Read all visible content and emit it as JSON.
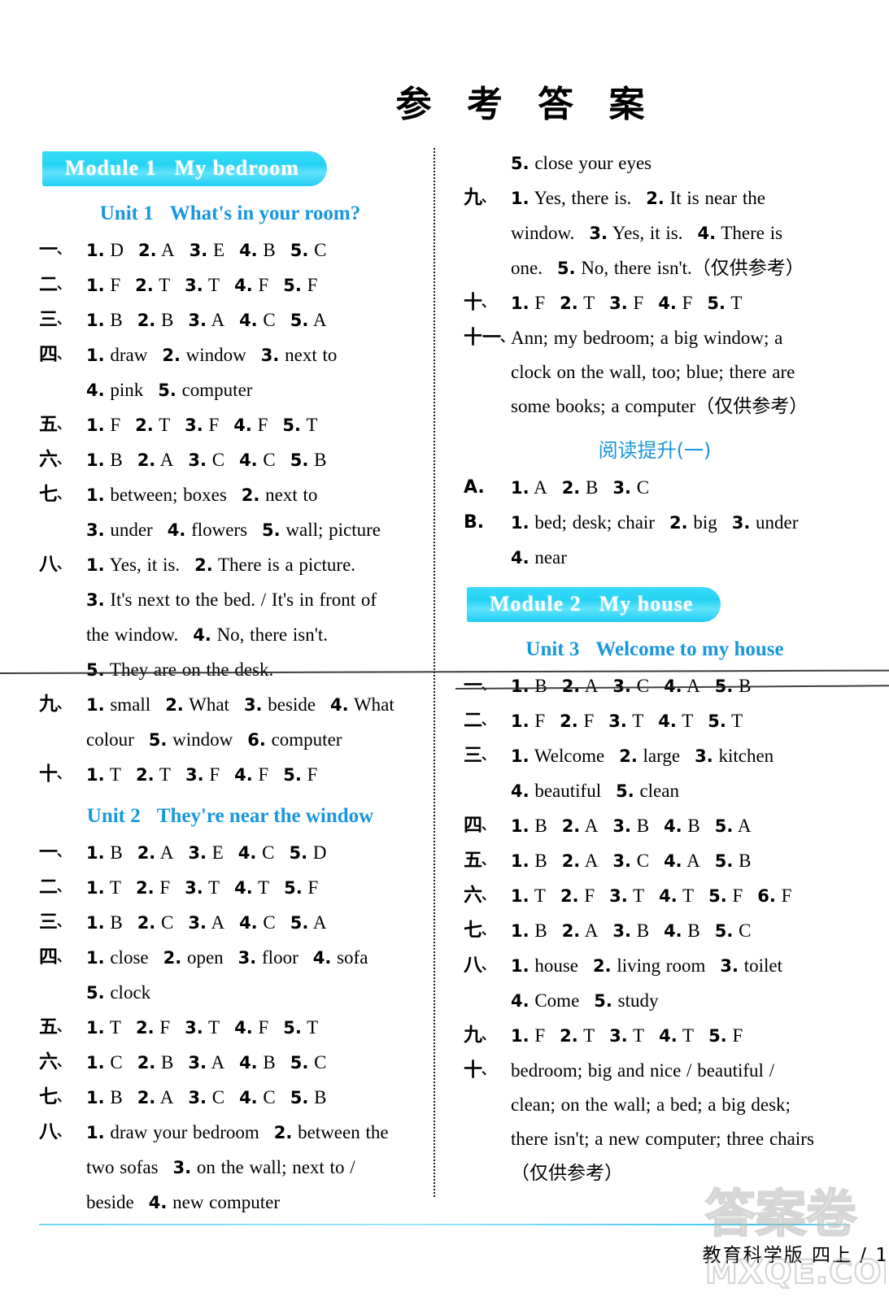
{
  "page": {
    "title": "参 考 答 案",
    "footer": "教育科学版 四上 / 1",
    "watermark_cn": "答案卷",
    "watermark_site": "MXQE.COM",
    "accent_cyan": "#25d2f4",
    "heading_blue": "#1897dd"
  },
  "left": {
    "module": {
      "name": "Module 1",
      "title": "My bedroom"
    },
    "unit1": {
      "name": "Unit 1",
      "title": "What's in your room?"
    },
    "unit1_answers": [
      {
        "label": "一、",
        "text": "1. D  2. A  3. E  4. B  5. C"
      },
      {
        "label": "二、",
        "text": "1. F  2. T  3. T  4. F  5. F"
      },
      {
        "label": "三、",
        "text": "1. B  2. B  3. A  4. C  5. A"
      },
      {
        "label": "四、",
        "text": "1. draw  2. window  3. next to"
      },
      {
        "label": "",
        "text": "4. pink  5. computer"
      },
      {
        "label": "五、",
        "text": "1. F  2. T  3. F  4. F  5. T"
      },
      {
        "label": "六、",
        "text": "1. B  2. A  3. C  4. C  5. B"
      },
      {
        "label": "七、",
        "text": "1. between; boxes  2. next to"
      },
      {
        "label": "",
        "text": "3. under  4. flowers  5. wall; picture"
      },
      {
        "label": "八、",
        "text": "1. Yes, it is.  2. There is a picture."
      },
      {
        "label": "",
        "text": "3. It's next to the bed. / It's in front of"
      },
      {
        "label": "",
        "text": "the window.  4. No, there isn't."
      },
      {
        "label": "",
        "text": "5. They are on the desk."
      },
      {
        "label": "九、",
        "text": "1. small  2. What  3. beside  4. What"
      },
      {
        "label": "",
        "text": "colour  5. window  6. computer"
      },
      {
        "label": "十、",
        "text": "1. T  2. T  3. F  4. F  5. F"
      }
    ],
    "unit2": {
      "name": "Unit 2",
      "title": "They're near the window"
    },
    "unit2_answers": [
      {
        "label": "一、",
        "text": "1. B  2. A  3. E  4. C  5. D"
      },
      {
        "label": "二、",
        "text": "1. T  2. F  3. T  4. T  5. F"
      },
      {
        "label": "三、",
        "text": "1. B  2. C  3. A  4. C  5. A"
      },
      {
        "label": "四、",
        "text": "1. close  2. open  3. floor  4. sofa"
      },
      {
        "label": "",
        "text": "5. clock"
      },
      {
        "label": "五、",
        "text": "1. T  2. F  3. T  4. F  5. T"
      },
      {
        "label": "六、",
        "text": "1. C  2. B  3. A  4. B  5. C"
      },
      {
        "label": "七、",
        "text": "1. B  2. A  3. C  4. C  5. B"
      },
      {
        "label": "八、",
        "text": "1. draw your bedroom  2. between the"
      },
      {
        "label": "",
        "text": "two sofas  3. on the wall; next to /"
      },
      {
        "label": "",
        "text": "beside  4. new computer"
      }
    ]
  },
  "right": {
    "unit2_cont": [
      {
        "label": "",
        "text": "5. close your eyes"
      },
      {
        "label": "九、",
        "text": "1. Yes, there is.  2. It is near the"
      },
      {
        "label": "",
        "text": "window.  3. Yes, it is.  4. There is"
      },
      {
        "label": "",
        "text": "one.  5. No, there isn't.（仅供参考）"
      },
      {
        "label": "十、",
        "text": "1. F  2. T  3. F  4. F  5. T"
      },
      {
        "label": "十一、",
        "text": "Ann; my bedroom; a big window; a"
      },
      {
        "label": "",
        "text": "clock on the wall, too; blue; there are"
      },
      {
        "label": "",
        "text": "some books; a computer（仅供参考）"
      }
    ],
    "reading": {
      "title": "阅读提升(一)"
    },
    "reading_answers": [
      {
        "label": "A.",
        "text": "1. A  2. B  3. C"
      },
      {
        "label": "B.",
        "text": "1. bed; desk; chair  2. big  3. under"
      },
      {
        "label": "",
        "text": "4. near"
      }
    ],
    "module": {
      "name": "Module 2",
      "title": "My house"
    },
    "unit3": {
      "name": "Unit 3",
      "title": "Welcome to my house"
    },
    "unit3_answers": [
      {
        "label": "一、",
        "text": "1. B  2. A  3. C  4. A  5. B"
      },
      {
        "label": "二、",
        "text": "1. F  2. F  3. T  4. T  5. T"
      },
      {
        "label": "三、",
        "text": "1. Welcome  2. large  3. kitchen"
      },
      {
        "label": "",
        "text": "4. beautiful  5. clean"
      },
      {
        "label": "四、",
        "text": "1. B  2. A  3. B  4. B  5. A"
      },
      {
        "label": "五、",
        "text": "1. B  2. A  3. C  4. A  5. B"
      },
      {
        "label": "六、",
        "text": "1. T  2. F  3. T  4. T  5. F  6. F"
      },
      {
        "label": "七、",
        "text": "1. B  2. A  3. B  4. B  5. C"
      },
      {
        "label": "八、",
        "text": "1. house  2. living room  3. toilet"
      },
      {
        "label": "",
        "text": "4. Come  5. study"
      },
      {
        "label": "九、",
        "text": "1. F  2. T  3. T  4. T  5. F"
      },
      {
        "label": "十、",
        "text": "bedroom; big and nice / beautiful /"
      },
      {
        "label": "",
        "text": "clean; on the wall; a bed; a big desk;"
      },
      {
        "label": "",
        "text": "there isn't; a new computer; three chairs"
      },
      {
        "label": "",
        "text": "（仅供参考）"
      }
    ]
  }
}
